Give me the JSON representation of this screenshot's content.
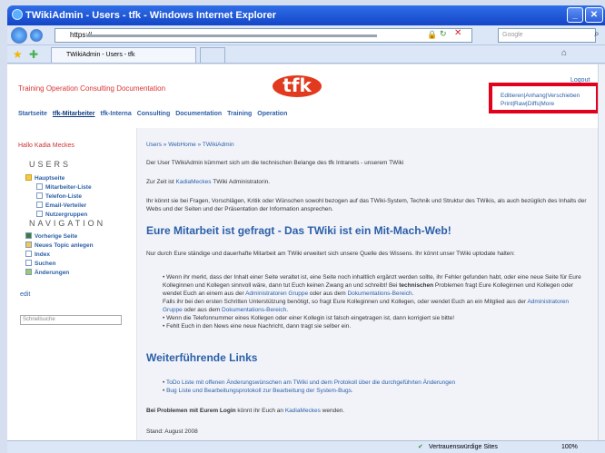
{
  "window": {
    "title": "TWikiAdmin - Users - tfk - Windows Internet Explorer",
    "url": "https://",
    "search_placeholder": "Google",
    "tab_title": "TWikiAdmin - Users - tfk",
    "status_zone": "Vertrauenswürdige Sites",
    "zoom": "100%"
  },
  "header": {
    "top_links": "Training Operation Consulting Documentation",
    "logo": "tfk",
    "logout": "Logout",
    "actions_line1": "Editieren|Anhang|Verschieben",
    "actions_line2": "Print|Raw|Diffs|More",
    "nav": [
      "Startseite",
      "tfk-Mitarbeiter",
      "tfk-Interna",
      "Consulting",
      "Documentation",
      "Training",
      "Operation"
    ]
  },
  "sidebar": {
    "greeting": "Hallo Kadia Meckes",
    "users_title": "USERS",
    "users_items": [
      "Hauptseite",
      "Mitarbeiter-Liste",
      "Telefon-Liste",
      "Email-Verteiler",
      "Nutzergruppen"
    ],
    "navigation_title": "NAVIGATION",
    "nav_items": [
      "Vorherige Seite",
      "Neues Topic anlegen",
      "Index",
      "Suchen",
      "Änderungen"
    ],
    "edit": "edit",
    "search_placeholder": "Schnellsuche"
  },
  "content": {
    "breadcrumb": "Users » WebHome » TWikiAdmin",
    "p1": "Der User TWikiAdmin kümmert sich um die technischen Belange des tfk Intranets - unserem TWiki",
    "p2_pre": "Zur Zeit ist ",
    "p2_link": "KadiaMeckes",
    "p2_post": " TWiki Administratorin.",
    "p3": "Ihr könnt sie bei Fragen, Vorschlägen, Kritik oder Wünschen sowohl bezogen auf das TWiki-System, Technik und Struktur des TWikis, als auch bezüglich des Inhalts der Webs und der Seiten und der Präsentation der Information ansprechen.",
    "h1": "Eure Mitarbeit ist gefragt - Das TWiki ist ein Mit-Mach-Web!",
    "p4": "Nur durch Eure ständige und dauerhafte Mitarbeit am TWiki erweitert sich unsere Quelle des Wissens. Ihr könnt unser TWiki uptodate halten:",
    "bullet1_a": "Wenn ihr merkt, dass der Inhalt einer Seite veraltet ist, eine Seite noch inhaltlich ergänzt werden sollte, ihr Fehler gefunden habt, oder eine neue Seite für Eure Kolleginnen und Kollegen sinnvoll wäre, dann tut Euch keinen Zwang an und schreibt! Bei",
    "bullet1_b": "technischen",
    "bullet1_c": " Problemen fragt Eure Kolleginnen und Kollegen oder wendet Euch an einem aus der ",
    "bullet1_link1": "Administratoren Gruppe",
    "bullet1_d": " oder aus dem ",
    "bullet1_link2": "Dokumentations-Bereich",
    "bullet1_e": "Falls ihr bei den ersten Schritten Unterstützung benötigt, so fragt Eure Kolleginnen und Kollegen, oder wendet Euch an ein Mitglied aus der ",
    "bullet1_link3": "Administratoren Gruppe",
    "bullet1_f": " oder aus dem ",
    "bullet1_link4": "Dokumentations-Bereich",
    "bullet2": "Wenn die Telefonnummer eines Kollegen oder einer Kollegin ist falsch eingetragen ist, dann korrigiert sie bitte!",
    "bullet3": "Fehlt Euch in den News eine neue Nachricht, dann tragt sie selber ein.",
    "h2": "Weiterführende Links",
    "link1": "ToDo Liste mit offenen Änderungswünschen am TWiki und dem Protokoll über die durchgeführten Änderungen",
    "link2": "Bug Liste und Bearbeitungsprotokoll zur Bearbeitung der System-Bugs.",
    "p5_b": "Bei Problemen mit Eurem Login",
    "p5_mid": " könnt ihr Euch an ",
    "p5_link": "KadiaMeckes",
    "p5_end": " wenden.",
    "stand": "Stand: August 2008"
  }
}
